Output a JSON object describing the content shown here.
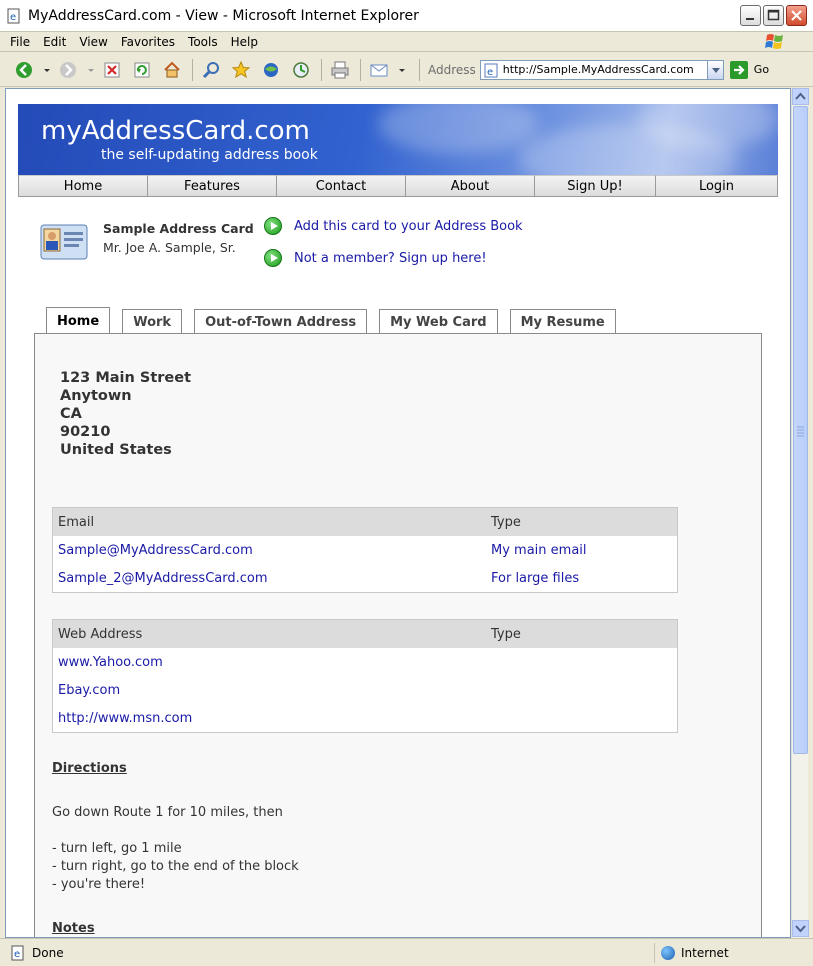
{
  "window": {
    "title": "MyAddressCard.com - View - Microsoft Internet Explorer"
  },
  "menu": [
    "File",
    "Edit",
    "View",
    "Favorites",
    "Tools",
    "Help"
  ],
  "toolbar": {
    "address_label": "Address",
    "url": "http://Sample.MyAddressCard.com",
    "go_label": "Go"
  },
  "status": {
    "text": "Done",
    "zone": "Internet"
  },
  "site": {
    "name": "myAddressCard.com",
    "tagline": "the self-updating address book"
  },
  "nav": [
    "Home",
    "Features",
    "Contact",
    "About",
    "Sign Up!",
    "Login"
  ],
  "card": {
    "title": "Sample Address Card",
    "owner": "Mr. Joe A. Sample, Sr.",
    "actions": [
      "Add this card to your Address Book",
      "Not a member? Sign up here!"
    ]
  },
  "tabs": [
    "Home",
    "Work",
    "Out-of-Town Address",
    "My Web Card",
    "My Resume"
  ],
  "address": [
    "123 Main Street",
    "Anytown",
    "CA",
    "90210",
    "United States"
  ],
  "email_table": {
    "headers": [
      "Email",
      "Type"
    ],
    "rows": [
      [
        "Sample@MyAddressCard.com",
        "My main email"
      ],
      [
        "Sample_2@MyAddressCard.com",
        "For large files"
      ]
    ]
  },
  "web_table": {
    "headers": [
      "Web Address",
      "Type"
    ],
    "rows": [
      [
        "www.Yahoo.com",
        ""
      ],
      [
        "Ebay.com",
        ""
      ],
      [
        "http://www.msn.com",
        ""
      ]
    ]
  },
  "directions": {
    "heading": "Directions",
    "intro": "Go down Route 1 for 10 miles, then",
    "steps": [
      "- turn left, go 1 mile",
      "- turn right, go to the end of the block",
      "- you're there!"
    ]
  },
  "notes": {
    "heading": "Notes"
  }
}
